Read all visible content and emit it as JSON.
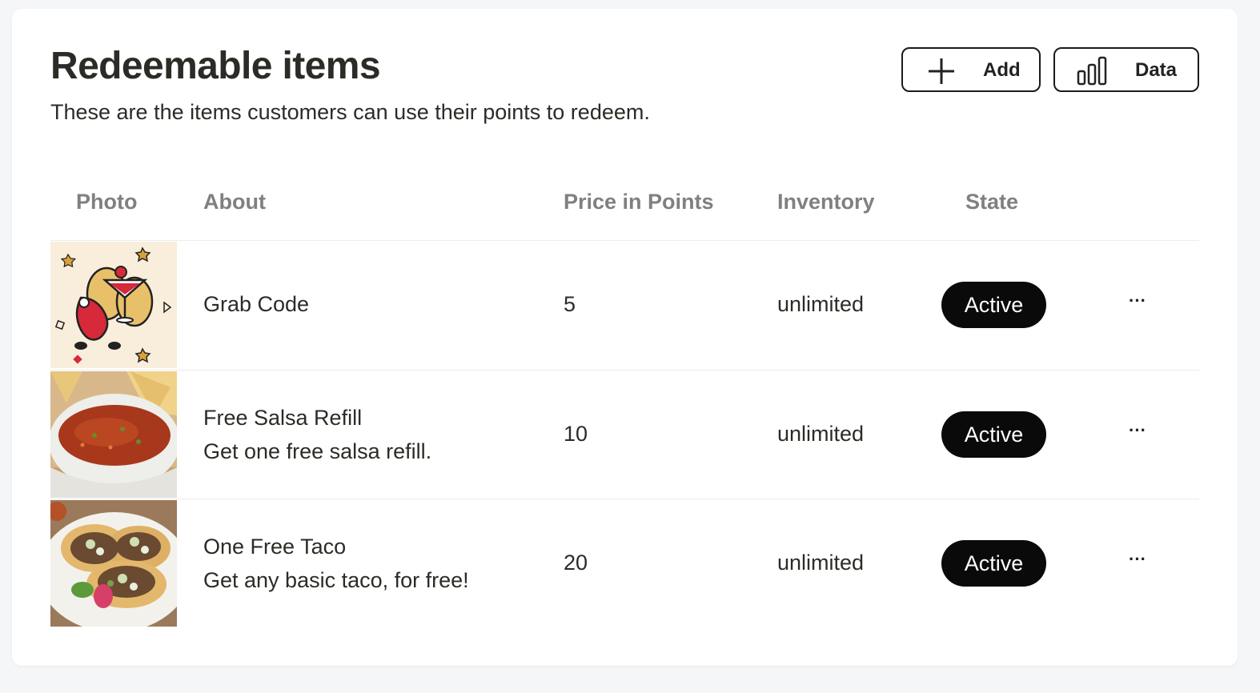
{
  "header": {
    "title": "Redeemable items",
    "subtitle": "These are the items customers can use their points to redeem.",
    "add_label": "Add",
    "data_label": "Data"
  },
  "table": {
    "columns": [
      "Photo",
      "About",
      "Price in Points",
      "Inventory",
      "State"
    ],
    "rows": [
      {
        "name": "Grab Code",
        "description": "",
        "price": "5",
        "inventory": "unlimited",
        "state": "Active",
        "more": "···"
      },
      {
        "name": "Free Salsa Refill",
        "description": "Get one free salsa refill.",
        "price": "10",
        "inventory": "unlimited",
        "state": "Active",
        "more": "···"
      },
      {
        "name": "One Free Taco",
        "description": "Get any basic taco, for free!",
        "price": "20",
        "inventory": "unlimited",
        "state": "Active",
        "more": "···"
      }
    ]
  },
  "colors": {
    "badge_bg": "#0a0a0a",
    "header_text": "#808080",
    "text": "#2b2c26"
  }
}
